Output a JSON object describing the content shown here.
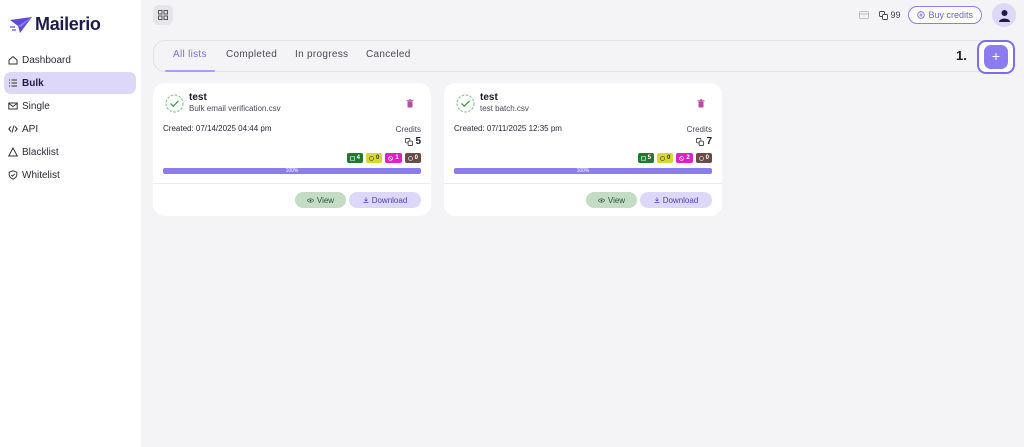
{
  "app": {
    "name": "Mailerio"
  },
  "sidebar": {
    "items": [
      {
        "label": "Dashboard",
        "icon": "home-icon"
      },
      {
        "label": "Bulk",
        "icon": "list-icon",
        "active": true
      },
      {
        "label": "Single",
        "icon": "mail-icon"
      },
      {
        "label": "API",
        "icon": "code-icon"
      },
      {
        "label": "Blacklist",
        "icon": "warning-icon"
      },
      {
        "label": "Whitelist",
        "icon": "shield-check-icon"
      }
    ]
  },
  "header": {
    "credits": "99",
    "buy_credits_label": "Buy credits"
  },
  "tabs": [
    {
      "label": "All lists",
      "active": true
    },
    {
      "label": "Completed"
    },
    {
      "label": "In progress"
    },
    {
      "label": "Canceled"
    }
  ],
  "annotation": {
    "step": "1."
  },
  "add_button": {
    "label": "+"
  },
  "cards": [
    {
      "title": "test",
      "file": "Bulk email verification.csv",
      "created": "Created: 07/14/2025 04:44 pm",
      "credits_label": "Credits",
      "credits": "5",
      "badges": [
        {
          "value": "4",
          "color": "#1f7a2e",
          "icon": "mail-check-icon"
        },
        {
          "value": "0",
          "color": "#d7d735",
          "icon": "question-icon"
        },
        {
          "value": "1",
          "color": "#e21fc7",
          "icon": "ban-icon"
        },
        {
          "value": "0",
          "color": "#6b4a4a",
          "icon": "block-icon"
        }
      ],
      "progress": "100%",
      "view_label": "View",
      "download_label": "Download"
    },
    {
      "title": "test",
      "file": "test batch.csv",
      "created": "Created: 07/11/2025 12:35 pm",
      "credits_label": "Credits",
      "credits": "7",
      "badges": [
        {
          "value": "5",
          "color": "#1f7a2e",
          "icon": "mail-check-icon"
        },
        {
          "value": "0",
          "color": "#d7d735",
          "icon": "question-icon"
        },
        {
          "value": "2",
          "color": "#e21fc7",
          "icon": "ban-icon"
        },
        {
          "value": "0",
          "color": "#6b4a4a",
          "icon": "block-icon"
        }
      ],
      "progress": "100%",
      "view_label": "View",
      "download_label": "Download"
    }
  ]
}
